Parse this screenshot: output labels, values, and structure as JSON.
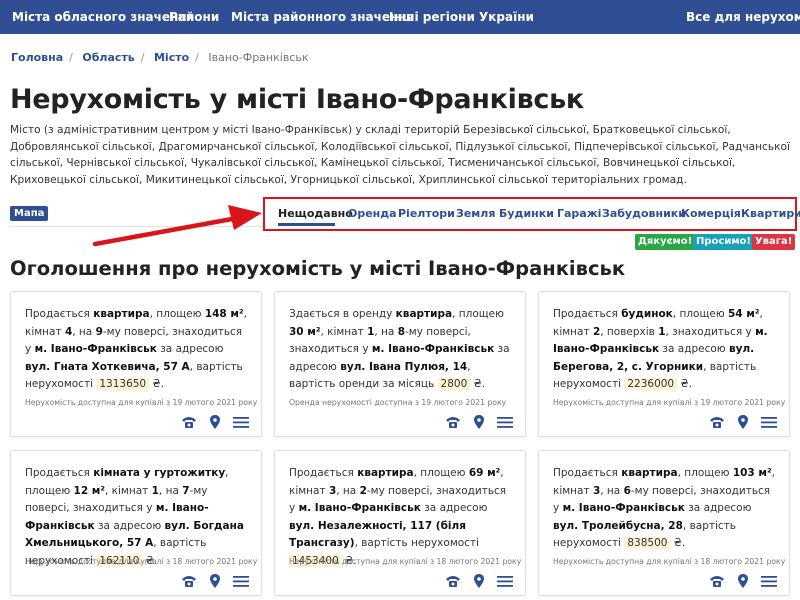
{
  "topnav": {
    "items": [
      "Міста обласного значення",
      "Райони",
      "Міста районного значення",
      "Інші регіони України"
    ],
    "right": "Все для нерухомості"
  },
  "breadcrumb": [
    "Головна",
    "Область",
    "Місто",
    "Івано-Франківськ"
  ],
  "title": "Нерухомість у місті Івано-Франківськ",
  "description": "Місто (з адміністративним центром у місті Івано-Франківськ) у складі територій Березівської сільської, Братковецької сільської, Добровлянської сільської, Драгомирчанської сільської, Колодіївської сільської, Підлузької сільської, Підпечерівської сільської, Радчанської сільської, Чернівської сільської, Чукалівської сільської, Камінецької сільської, Тисменичанської сільської, Вовчинецької сільської, Криховецької сільської, Микитинецької сільської, Угорницької сільської, Хриплинської сільської територіальних громад.",
  "map_label": "Мапа",
  "tabs": [
    "Нещодавно",
    "Оренда",
    "Ріелтори",
    "Земля",
    "Будинки",
    "Гаражі",
    "Забудовники",
    "Комерція",
    "Квартири"
  ],
  "buttons": {
    "thanks": "Дякуємо!",
    "please": "Просимо!",
    "attention": "Увага!"
  },
  "colors": {
    "nav": "#2f4e94",
    "thanks": "#28a745",
    "please": "#17a2b8",
    "attention": "#dc3545",
    "highlight": "#d9141b"
  },
  "section_title": "Оголошення про нерухомість у місті Івано-Франківськ",
  "cards": [
    {
      "t1": "Продається ",
      "b1": "квартира",
      "t2": ", площею ",
      "b2": "148 м²",
      "t3": ", кімнат ",
      "b3": "4",
      "t4": ", на ",
      "b4": "9",
      "t5": "-му поверсі, знаходиться у ",
      "b5": "м. Івано-Франківськ",
      "t6": " за адресою ",
      "b6": "вул. Гната Хоткевича, 57 А",
      "t7": ", вартість нерухомості ",
      "price": "1313650",
      "t8": " ₴.",
      "avail": "Нерухомість доступна для купівлі з 19 лютого 2021 року"
    },
    {
      "t1": "Здається в оренду ",
      "b1": "квартира",
      "t2": ", площею ",
      "b2": "30 м²",
      "t3": ", кімнат ",
      "b3": "1",
      "t4": ", на ",
      "b4": "8",
      "t5": "-му поверсі, знаходиться у ",
      "b5": "м. Івано-Франківськ",
      "t6": " за адресою ",
      "b6": "вул. Івана Пулюя, 14",
      "t7": ", вартість оренди за місяць ",
      "price": "2800",
      "t8": " ₴.",
      "avail": "Оренда нерухомості доступна з 19 лютого 2021 року"
    },
    {
      "t1": "Продається ",
      "b1": "будинок",
      "t2": ", площею ",
      "b2": "54 м²",
      "t3": ", кімнат ",
      "b3": "2",
      "t4": ", поверхів ",
      "b4": "1",
      "t5": ", знаходиться у ",
      "b5": "м. Івано-Франківськ",
      "t6": " за адресою ",
      "b6": "вул. Берегова, 2, с. Угорники",
      "t7": ", вартість нерухомості ",
      "price": "2236000",
      "t8": " ₴.",
      "avail": "Нерухомість доступна для купівлі з 19 лютого 2021 року"
    },
    {
      "t1": "Продається ",
      "b1": "кімната у гуртожитку",
      "t2": ", площею ",
      "b2": "12 м²",
      "t3": ", кімнат ",
      "b3": "1",
      "t4": ", на ",
      "b4": "7",
      "t5": "-му поверсі, знаходиться у ",
      "b5": "м. Івано-Франківськ",
      "t6": " за адресою ",
      "b6": "вул. Богдана Хмельницького, 57 А",
      "t7": ", вартість нерухомості ",
      "price": "162110",
      "t8": " ₴.",
      "avail": "Нерухомість доступна для купівлі з 18 лютого 2021 року"
    },
    {
      "t1": "Продається ",
      "b1": "квартира",
      "t2": ", площею ",
      "b2": "69 м²",
      "t3": ", кімнат ",
      "b3": "3",
      "t4": ", на ",
      "b4": "2",
      "t5": "-му поверсі, знаходиться у ",
      "b5": "м. Івано-Франківськ",
      "t6": " за адресою ",
      "b6": "вул. Незалежності, 117 (біля Трансгазу)",
      "t7": ", вартість нерухомості ",
      "price": "1453400",
      "t8": " ₴.",
      "avail": "Нерухомість доступна для купівлі з 18 лютого 2021 року"
    },
    {
      "t1": "Продається ",
      "b1": "квартира",
      "t2": ", площею ",
      "b2": "103 м²",
      "t3": ", кімнат ",
      "b3": "3",
      "t4": ", на ",
      "b4": "6",
      "t5": "-му поверсі, знаходиться у ",
      "b5": "м. Івано-Франківськ",
      "t6": " за адресою ",
      "b6": "вул. Тролейбусна, 28",
      "t7": ", вартість нерухомості ",
      "price": "838500",
      "t8": " ₴.",
      "avail": "Нерухомість доступна для купівлі з 18 лютого 2021 року"
    }
  ]
}
